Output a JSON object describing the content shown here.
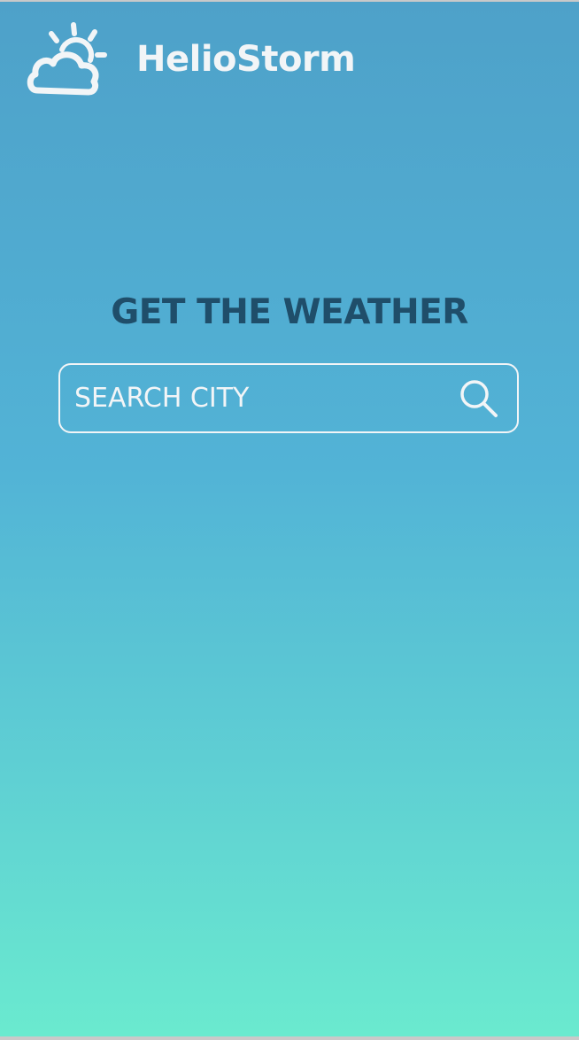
{
  "app": {
    "name": "HelioStorm",
    "logo_icon": "sun-behind-cloud-icon"
  },
  "main": {
    "headline": "GET THE WEATHER",
    "search": {
      "placeholder": "SEARCH CITY",
      "value": "",
      "button_icon": "search-icon"
    }
  },
  "colors": {
    "gradient_top": "#4ea1c9",
    "gradient_bottom": "#6aeacf",
    "headline_text": "#1f4e6a",
    "foreground": "#f2f5f7"
  }
}
